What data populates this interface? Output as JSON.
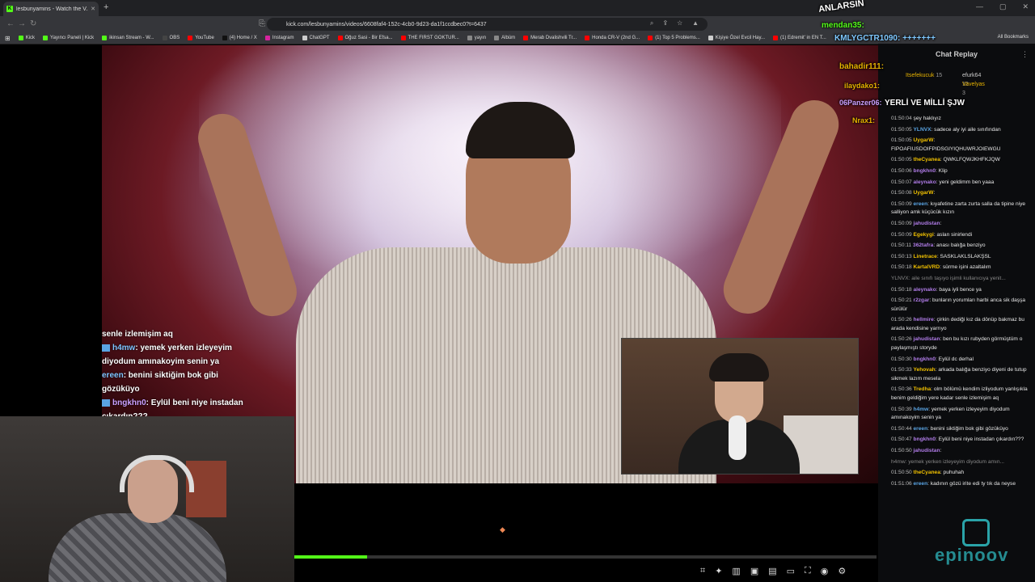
{
  "browser": {
    "tab_title": "lesbunyamins - Watch the V...",
    "tab_fav": "K",
    "url": "kick.com/lesbunyamins/videos/6608faf4-152c-4cb0-9d23-da1f1ccdbec0?t=6437",
    "all_bookmarks": "All Bookmarks",
    "bookmarks": [
      {
        "label": "Kick",
        "color": "#53fc18"
      },
      {
        "label": "Yayıncı Paneli | Kick",
        "color": "#53fc18"
      },
      {
        "label": "ikinsan Stream - W...",
        "color": "#53fc18"
      },
      {
        "label": "OBS",
        "color": "#444"
      },
      {
        "label": "YouTube",
        "color": "#ff0000"
      },
      {
        "label": "(4) Home / X",
        "color": "#000"
      },
      {
        "label": "Instagram",
        "color": "#d6249f"
      },
      {
        "label": "ChatGPT",
        "color": "#ccc"
      },
      {
        "label": "Oğuz Sasi - Bir Efsa...",
        "color": "#ff0000"
      },
      {
        "label": "THE FIRST GOKTUR...",
        "color": "#ff0000"
      },
      {
        "label": "yayın",
        "color": "#888"
      },
      {
        "label": "Albüm",
        "color": "#888"
      },
      {
        "label": "Merab Dvalishvili Tr...",
        "color": "#ff0000"
      },
      {
        "label": "Honda CR-V (2nd G...",
        "color": "#ff0000"
      },
      {
        "label": "(1) Top 5 Problems...",
        "color": "#ff0000"
      },
      {
        "label": "Kişiye Özel Evcil Hay...",
        "color": "#ccc"
      },
      {
        "label": "(1) Edremit' in EN T...",
        "color": "#ff0000"
      }
    ]
  },
  "subtitles": {
    "line0": "senle izlemişim aq",
    "l1_user": "h4mw",
    "l1_text": ": yemek yerken izleyeyim",
    "l1_cont": "diyodum amınakoyim senin ya",
    "l2_user": "ereen",
    "l2_text": ": benini siktiğim bok gibi",
    "l2_cont": "gözüküyo",
    "l3_user": "bngkhn0",
    "l3_text": ": Eylül beni niye instadan",
    "l3_cont": "çıkardın???"
  },
  "player": {
    "progress_fraction": 0.125
  },
  "overlay": {
    "anlarsin": "ANLARSIN",
    "mendan": "mendan35:",
    "kmly": "KMLYGCTR1090: +++++++",
    "bahadir": "bahadir111:",
    "ilayda": "ilaydako1:",
    "panzer": "06Panzer06:",
    "yerli": "YERLİ VE MİLLİ ŞJW",
    "nrax": "Nrax1:"
  },
  "chat": {
    "title": "Chat Replay",
    "gifters": [
      {
        "name": "Itsefekucuk",
        "count": "15"
      },
      {
        "name": "efurk64",
        "count": "12"
      },
      {
        "name": "Vavelyas",
        "count": "3"
      }
    ],
    "messages": [
      {
        "ts": "01:50:04",
        "user": "",
        "color": "#bbb",
        "text": "şey haklıyız"
      },
      {
        "ts": "01:50:05",
        "user": "YLNVX",
        "color": "#5aa4e3",
        "text": "sadece aly iyi aile sınıfından"
      },
      {
        "ts": "01:50:05",
        "user": "UygarW",
        "color": "#f0c000",
        "text": "FIPOAFIUSDOIFPIDSGIYIQHUWRJOIEWGU"
      },
      {
        "ts": "01:50:05",
        "user": "theCyanea",
        "color": "#f0c000",
        "text": "QWKLFQWJKHFKJQW"
      },
      {
        "ts": "01:50:06",
        "user": "bngkhn0",
        "color": "#b07ce8",
        "text": "Klip"
      },
      {
        "ts": "01:50:07",
        "user": "aleynako",
        "color": "#b07ce8",
        "text": "yeni geldimm ben yaaa"
      },
      {
        "ts": "01:50:08",
        "user": "UygarW",
        "color": "#f0c000",
        "text": ""
      },
      {
        "ts": "01:50:09",
        "user": "ereen",
        "color": "#5aa4e3",
        "text": "kıyafetine zarta zurta salla da tipine niye salliyon amk küçücük kızın"
      },
      {
        "ts": "01:50:09",
        "user": "jahudistan",
        "color": "#b07ce8",
        "text": ""
      },
      {
        "ts": "01:50:09",
        "user": "Egekygi",
        "color": "#f0c000",
        "text": "aslan sinirlendi"
      },
      {
        "ts": "01:50:11",
        "user": "362tafra",
        "color": "#b07ce8",
        "text": "anası balığa benziyo"
      },
      {
        "ts": "01:50:13",
        "user": "Linetrace",
        "color": "#f0c000",
        "text": "SASKLAKLSLAKŞSL"
      },
      {
        "ts": "01:50:18",
        "user": "KartalVRD",
        "color": "#f0c000",
        "text": "sürme işini azaltalım"
      },
      {
        "ts": "",
        "user": "",
        "color": "#888",
        "text": "YLNVX: aile sınıfı taşıyo işimli kullanıcıya yenit..."
      },
      {
        "ts": "01:50:18",
        "user": "aleynako",
        "color": "#b07ce8",
        "text": "baya iyli bence ya"
      },
      {
        "ts": "01:50:21",
        "user": "r2zgar",
        "color": "#b07ce8",
        "text": "bunların yorumları harbi anca sik daşşa sürülür"
      },
      {
        "ts": "01:50:26",
        "user": "hellmire",
        "color": "#b07ce8",
        "text": "çirkin dediği kız da dönüp bakmaz bu arada kendisine yarrıyo"
      },
      {
        "ts": "01:50:26",
        "user": "jahudistan",
        "color": "#b07ce8",
        "text": "ben bu kızı rubyden görmüştüm o paylaşmıştı storyde"
      },
      {
        "ts": "01:50:30",
        "user": "bngkhn0",
        "color": "#b07ce8",
        "text": "Eylül dc derhal"
      },
      {
        "ts": "01:50:33",
        "user": "Yehovah",
        "color": "#f0c000",
        "text": "arkada balığa benziyo diyeni de tutup sikmek lazım mesela"
      },
      {
        "ts": "01:50:36",
        "user": "Tredha",
        "color": "#f0c000",
        "text": "olm bölümü kendim izliyodum yanlışıkla benim geldiğim yere kadar senle izlemişim aq"
      },
      {
        "ts": "01:50:39",
        "user": "h4mw",
        "color": "#5aa4e3",
        "text": "yemek yerken izleyeyim diyodum amınakoyim senin ya"
      },
      {
        "ts": "01:50:44",
        "user": "ereen",
        "color": "#5aa4e3",
        "text": "benini siktiğim bok gibi gözüküyo"
      },
      {
        "ts": "01:50:47",
        "user": "bngkhn0",
        "color": "#b07ce8",
        "text": "Eylül beni niye instadan çıkardın???"
      },
      {
        "ts": "01:50:50",
        "user": "jahudistan",
        "color": "#b07ce8",
        "text": ""
      },
      {
        "ts": "",
        "user": "",
        "color": "#888",
        "text": "h4mw: yemek yerken izleyeyim diyodum amın..."
      },
      {
        "ts": "01:50:50",
        "user": "theCyanea",
        "color": "#f0c000",
        "text": "puhuhah"
      },
      {
        "ts": "01:51:06",
        "user": "ereen",
        "color": "#5aa4e3",
        "text": "kadının gözü irite edi ty tık da neyse"
      }
    ]
  },
  "watermark": "epinoov"
}
